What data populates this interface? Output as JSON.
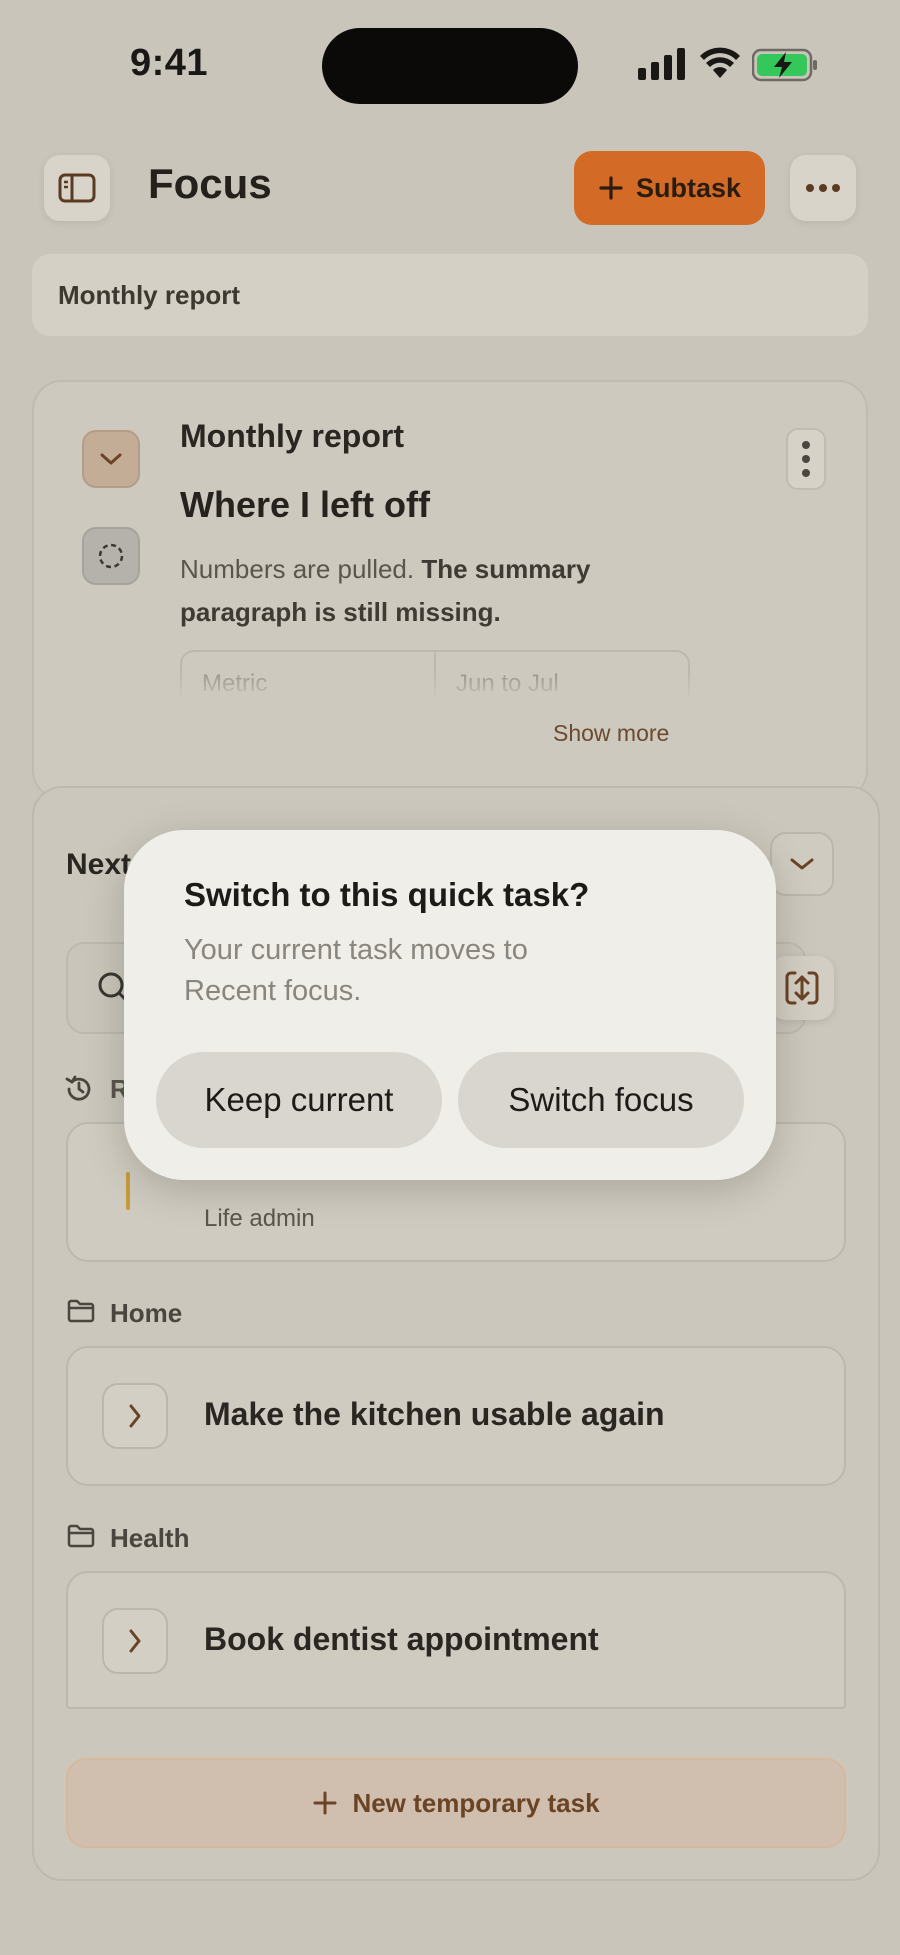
{
  "status_bar": {
    "time": "9:41"
  },
  "header": {
    "title": "Focus",
    "subtask_label": "Subtask",
    "icons": {
      "sidebar": "sidebar-toggle-icon",
      "more": "ellipsis-icon",
      "add": "plus-icon"
    }
  },
  "breadcrumb": {
    "label": "Monthly report"
  },
  "focus_card": {
    "kicker": "Monthly report",
    "heading": "Where I left off",
    "body_plain": "Numbers are pulled. ",
    "body_bold": "The summary paragraph is still missing.",
    "table_headers": [
      "Metric",
      "Jun to Jul"
    ],
    "show_more": "Show more"
  },
  "next_panel": {
    "label": "Next",
    "recent_letter": "R",
    "recent_item": {
      "category": "Life admin"
    },
    "groups": [
      {
        "name": "Home",
        "task": "Make the kitchen usable again"
      },
      {
        "name": "Health",
        "task": "Book dentist appointment"
      }
    ],
    "new_temp_label": "New temporary task"
  },
  "dialog": {
    "title": "Switch to this quick task?",
    "message": "Your current task moves to Recent focus.",
    "keep_label": "Keep current",
    "switch_label": "Switch focus"
  },
  "colors": {
    "accent": "#d36a26",
    "background": "#c9c5ba",
    "dialog": "#f0eee8",
    "recent_accent": "#c79b3a"
  }
}
